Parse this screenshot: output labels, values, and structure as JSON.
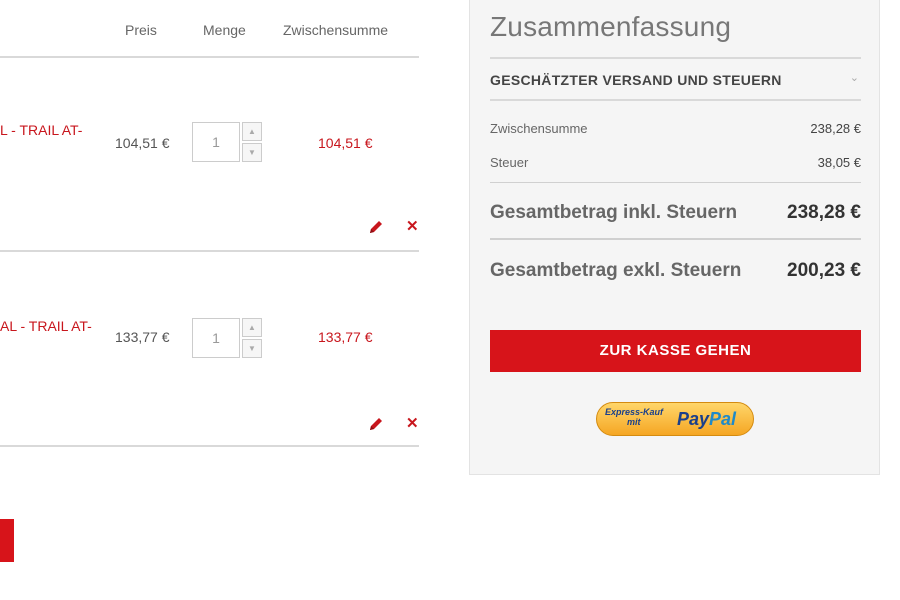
{
  "cart": {
    "headers": {
      "price": "Preis",
      "qty": "Menge",
      "subtotal": "Zwischensumme"
    },
    "items": [
      {
        "name": "L - TRAIL AT-",
        "price": "104,51 €",
        "qty": "1",
        "subtotal": "104,51 €"
      },
      {
        "name": "AL - TRAIL AT-",
        "price": "133,77 €",
        "qty": "1",
        "subtotal": "133,77 €"
      }
    ]
  },
  "summary": {
    "title": "Zusammenfassung",
    "shipping_label": "GESCHÄTZTER VERSAND UND STEUERN",
    "subtotal_label": "Zwischensumme",
    "subtotal_value": "238,28 €",
    "tax_label": "Steuer",
    "tax_value": "38,05 €",
    "grand_incl_label": "Gesamtbetrag inkl. Steuern",
    "grand_incl_value": "238,28 €",
    "grand_excl_label": "Gesamtbetrag exkl. Steuern",
    "grand_excl_value": "200,23 €",
    "checkout_label": "ZUR KASSE GEHEN",
    "paypal": {
      "line1": "Express-Kauf",
      "line2": "mit",
      "pay": "Pay",
      "pal": "Pal"
    }
  },
  "icons": {
    "edit": "pencil-icon",
    "remove": "close-icon",
    "chevron": "chevron-down-icon",
    "up": "spinner-up-icon",
    "down": "spinner-down-icon"
  },
  "colors": {
    "accent": "#d7141a",
    "product_link": "#c8161d",
    "summary_bg": "#f5f5f5"
  }
}
